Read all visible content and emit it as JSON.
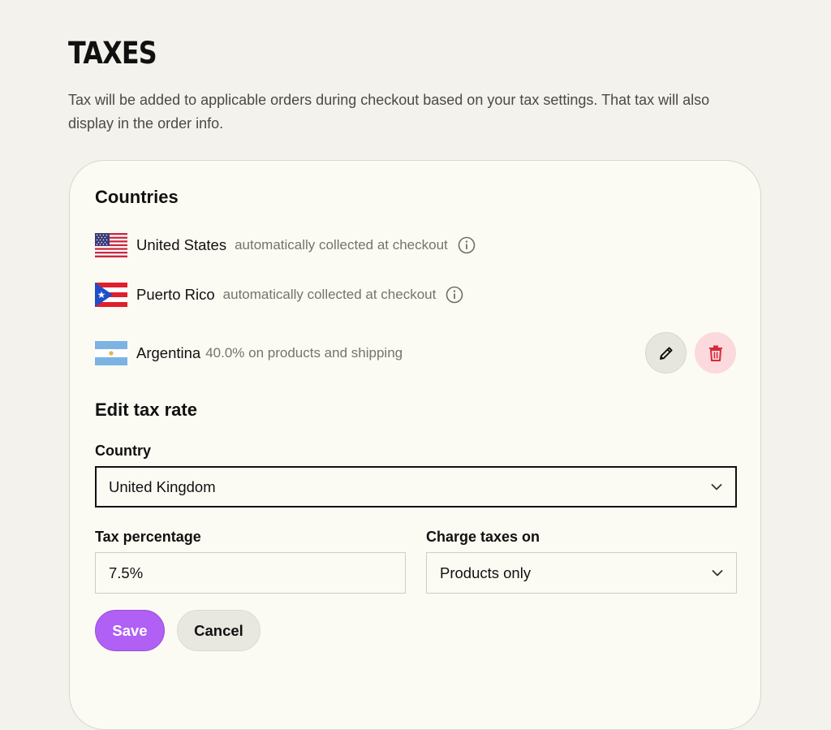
{
  "page": {
    "title": "TAXES",
    "description": "Tax will be added to applicable orders during checkout based on your tax settings. That tax will also display in the order info."
  },
  "countries": {
    "title": "Countries",
    "items": [
      {
        "name": "United States",
        "note": "automatically collected at checkout",
        "icon": "info-icon"
      },
      {
        "name": "Puerto Rico",
        "note": "automatically collected at checkout",
        "icon": "info-icon"
      },
      {
        "name": "Argentina",
        "note": "40.0% on products and shipping",
        "icon": "none"
      }
    ]
  },
  "edit": {
    "title": "Edit tax rate",
    "country_label": "Country",
    "country_value": "United Kingdom",
    "tax_label": "Tax percentage",
    "tax_value": "7.5%",
    "charge_label": "Charge taxes on",
    "charge_value": "Products only",
    "save_label": "Save",
    "cancel_label": "Cancel"
  },
  "colors": {
    "background": "#f3f2ec",
    "card": "#fcfbf3",
    "accent": "#b060f4",
    "delete_bg": "#fbd9dc",
    "delete_icon": "#d62b3a"
  }
}
